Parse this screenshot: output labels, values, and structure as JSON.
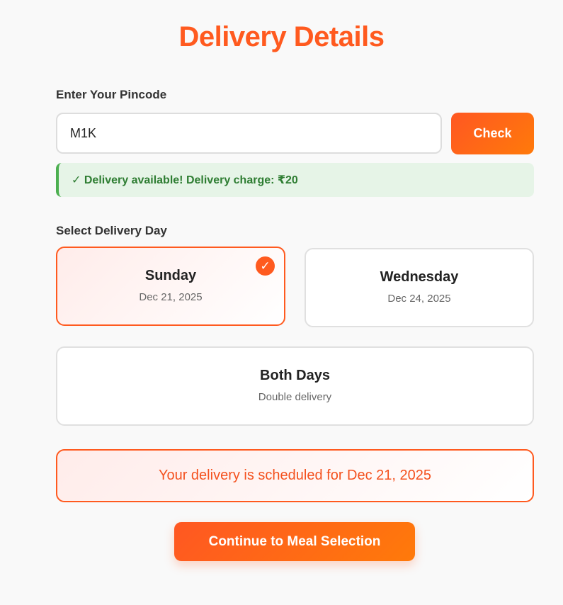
{
  "page": {
    "title": "Delivery Details"
  },
  "pincode": {
    "label": "Enter Your Pincode",
    "value": "M1K",
    "check_label": "Check",
    "status_icon": "✓",
    "status_text": "Delivery available! Delivery charge: ₹20"
  },
  "delivery_day": {
    "label": "Select Delivery Day",
    "options": [
      {
        "name": "Sunday",
        "sub": "Dec 21, 2025",
        "selected": true
      },
      {
        "name": "Wednesday",
        "sub": "Dec 24, 2025",
        "selected": false
      },
      {
        "name": "Both Days",
        "sub": "Double delivery",
        "selected": false
      }
    ],
    "selected_icon": "✓"
  },
  "schedule_message": "Your delivery is scheduled for Dec 21, 2025",
  "continue_label": "Continue to Meal Selection",
  "colors": {
    "accent": "#ff5a1f",
    "success_text": "#2e7d32",
    "success_bg": "#e6f4e7"
  }
}
